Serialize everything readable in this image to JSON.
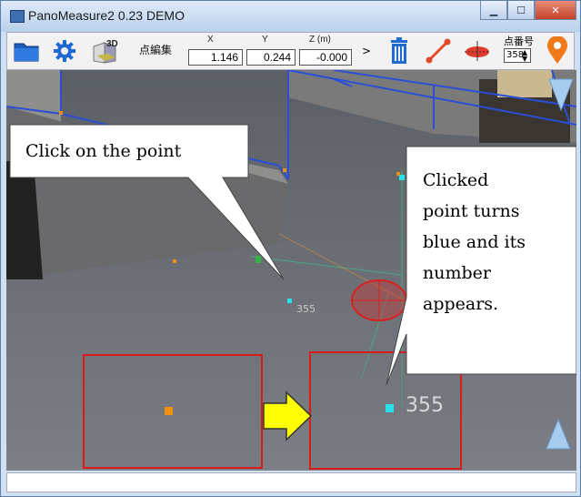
{
  "window": {
    "title": "PanoMeasure2 0.23 DEMO",
    "controls": [
      "minimize",
      "maximize",
      "close"
    ]
  },
  "toolbar": {
    "open_icon": "folder-icon",
    "settings_icon": "gear-icon",
    "view3d_icon": "3d-cube-icon",
    "view3d_label": "3D",
    "edit_points_label": "点編集",
    "coord_headers": {
      "x": "X",
      "y": "Y",
      "z": "Z (m)"
    },
    "coord_values": {
      "x": "1.146",
      "y": "0.244",
      "z": "-0.000"
    },
    "next_label": ">",
    "delete_icon": "trash-icon",
    "line_icon": "line-measure-icon",
    "disk_icon": "red-disk-icon",
    "point_number_label": "点番号",
    "point_number_value": "358",
    "pin_icon": "location-pin-icon"
  },
  "viewport": {
    "point_label_small": "355",
    "point_label_large": "355",
    "callout_left": "Click on the point",
    "callout_right_lines": [
      "Clicked",
      "point turns",
      "blue and its",
      "number",
      "appears."
    ],
    "colors": {
      "selected_point": "#27e0e8",
      "unselected_point": "#f09010",
      "highlight_box": "#d81b1b",
      "arrow_fill": "#ffff00",
      "mesh_lines": "#2a4fd6"
    }
  },
  "nav": {
    "up_arrow_icon": "triangle-down-icon",
    "down_arrow_icon": "triangle-up-icon"
  }
}
